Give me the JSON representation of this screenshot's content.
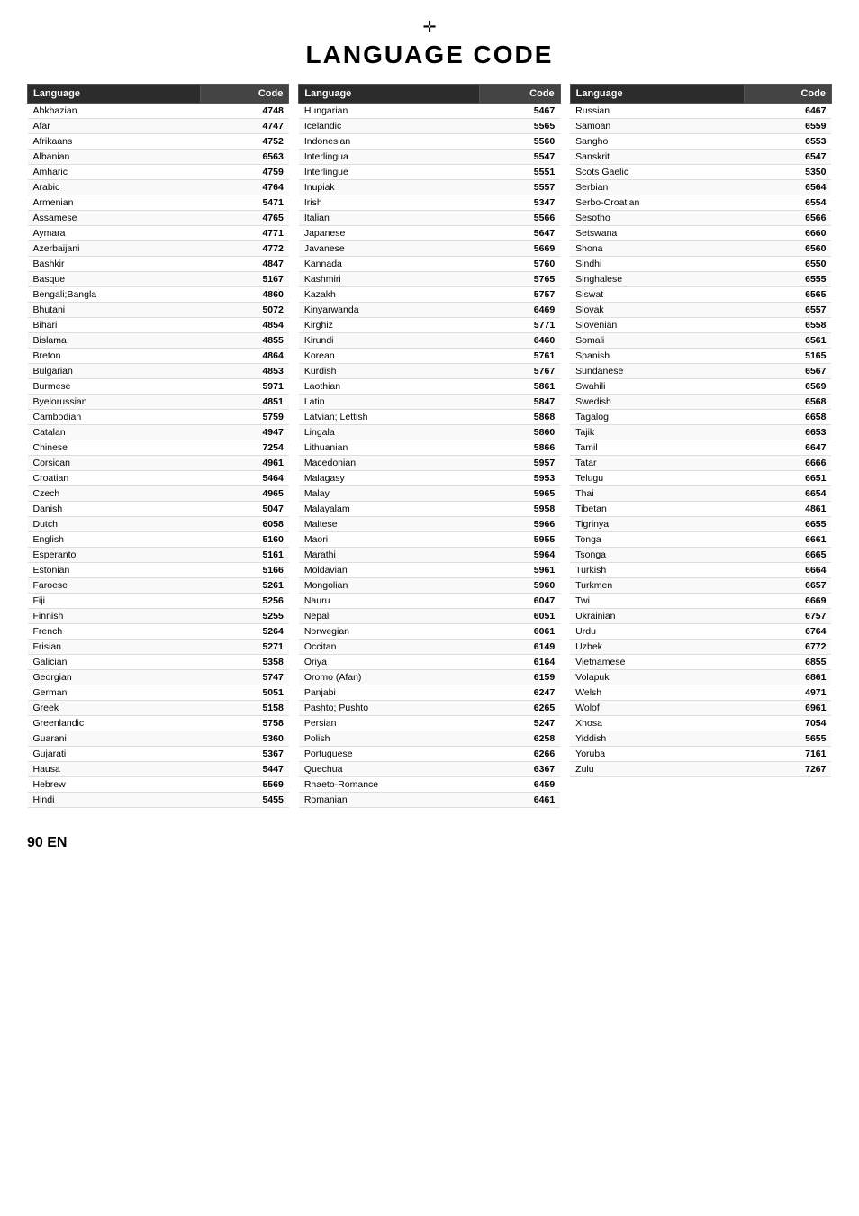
{
  "title": "LANGUAGE CODE",
  "columns": [
    {
      "header_lang": "Language",
      "header_code": "Code",
      "rows": [
        {
          "lang": "Abkhazian",
          "code": "4748"
        },
        {
          "lang": "Afar",
          "code": "4747"
        },
        {
          "lang": "Afrikaans",
          "code": "4752"
        },
        {
          "lang": "Albanian",
          "code": "6563"
        },
        {
          "lang": "Amharic",
          "code": "4759"
        },
        {
          "lang": "Arabic",
          "code": "4764"
        },
        {
          "lang": "Armenian",
          "code": "5471"
        },
        {
          "lang": "Assamese",
          "code": "4765"
        },
        {
          "lang": "Aymara",
          "code": "4771"
        },
        {
          "lang": "Azerbaijani",
          "code": "4772"
        },
        {
          "lang": "Bashkir",
          "code": "4847"
        },
        {
          "lang": "Basque",
          "code": "5167"
        },
        {
          "lang": "Bengali;Bangla",
          "code": "4860"
        },
        {
          "lang": "Bhutani",
          "code": "5072"
        },
        {
          "lang": "Bihari",
          "code": "4854"
        },
        {
          "lang": "Bislama",
          "code": "4855"
        },
        {
          "lang": "Breton",
          "code": "4864"
        },
        {
          "lang": "Bulgarian",
          "code": "4853"
        },
        {
          "lang": "Burmese",
          "code": "5971"
        },
        {
          "lang": "Byelorussian",
          "code": "4851"
        },
        {
          "lang": "Cambodian",
          "code": "5759"
        },
        {
          "lang": "Catalan",
          "code": "4947"
        },
        {
          "lang": "Chinese",
          "code": "7254"
        },
        {
          "lang": "Corsican",
          "code": "4961"
        },
        {
          "lang": "Croatian",
          "code": "5464"
        },
        {
          "lang": "Czech",
          "code": "4965"
        },
        {
          "lang": "Danish",
          "code": "5047"
        },
        {
          "lang": "Dutch",
          "code": "6058"
        },
        {
          "lang": "English",
          "code": "5160"
        },
        {
          "lang": "Esperanto",
          "code": "5161"
        },
        {
          "lang": "Estonian",
          "code": "5166"
        },
        {
          "lang": "Faroese",
          "code": "5261"
        },
        {
          "lang": "Fiji",
          "code": "5256"
        },
        {
          "lang": "Finnish",
          "code": "5255"
        },
        {
          "lang": "French",
          "code": "5264"
        },
        {
          "lang": "Frisian",
          "code": "5271"
        },
        {
          "lang": "Galician",
          "code": "5358"
        },
        {
          "lang": "Georgian",
          "code": "5747"
        },
        {
          "lang": "German",
          "code": "5051"
        },
        {
          "lang": "Greek",
          "code": "5158"
        },
        {
          "lang": "Greenlandic",
          "code": "5758"
        },
        {
          "lang": "Guarani",
          "code": "5360"
        },
        {
          "lang": "Gujarati",
          "code": "5367"
        },
        {
          "lang": "Hausa",
          "code": "5447"
        },
        {
          "lang": "Hebrew",
          "code": "5569"
        },
        {
          "lang": "Hindi",
          "code": "5455"
        }
      ]
    },
    {
      "header_lang": "Language",
      "header_code": "Code",
      "rows": [
        {
          "lang": "Hungarian",
          "code": "5467"
        },
        {
          "lang": "Icelandic",
          "code": "5565"
        },
        {
          "lang": "Indonesian",
          "code": "5560"
        },
        {
          "lang": "Interlingua",
          "code": "5547"
        },
        {
          "lang": "Interlingue",
          "code": "5551"
        },
        {
          "lang": "Inupiak",
          "code": "5557"
        },
        {
          "lang": "Irish",
          "code": "5347"
        },
        {
          "lang": "Italian",
          "code": "5566"
        },
        {
          "lang": "Japanese",
          "code": "5647"
        },
        {
          "lang": "Javanese",
          "code": "5669"
        },
        {
          "lang": "Kannada",
          "code": "5760"
        },
        {
          "lang": "Kashmiri",
          "code": "5765"
        },
        {
          "lang": "Kazakh",
          "code": "5757"
        },
        {
          "lang": "Kinyarwanda",
          "code": "6469"
        },
        {
          "lang": "Kirghiz",
          "code": "5771"
        },
        {
          "lang": "Kirundi",
          "code": "6460"
        },
        {
          "lang": "Korean",
          "code": "5761"
        },
        {
          "lang": "Kurdish",
          "code": "5767"
        },
        {
          "lang": "Laothian",
          "code": "5861"
        },
        {
          "lang": "Latin",
          "code": "5847"
        },
        {
          "lang": "Latvian; Lettish",
          "code": "5868"
        },
        {
          "lang": "Lingala",
          "code": "5860"
        },
        {
          "lang": "Lithuanian",
          "code": "5866"
        },
        {
          "lang": "Macedonian",
          "code": "5957"
        },
        {
          "lang": "Malagasy",
          "code": "5953"
        },
        {
          "lang": "Malay",
          "code": "5965"
        },
        {
          "lang": "Malayalam",
          "code": "5958"
        },
        {
          "lang": "Maltese",
          "code": "5966"
        },
        {
          "lang": "Maori",
          "code": "5955"
        },
        {
          "lang": "Marathi",
          "code": "5964"
        },
        {
          "lang": "Moldavian",
          "code": "5961"
        },
        {
          "lang": "Mongolian",
          "code": "5960"
        },
        {
          "lang": "Nauru",
          "code": "6047"
        },
        {
          "lang": "Nepali",
          "code": "6051"
        },
        {
          "lang": "Norwegian",
          "code": "6061"
        },
        {
          "lang": "Occitan",
          "code": "6149"
        },
        {
          "lang": "Oriya",
          "code": "6164"
        },
        {
          "lang": "Oromo (Afan)",
          "code": "6159"
        },
        {
          "lang": "Panjabi",
          "code": "6247"
        },
        {
          "lang": "Pashto; Pushto",
          "code": "6265"
        },
        {
          "lang": "Persian",
          "code": "5247"
        },
        {
          "lang": "Polish",
          "code": "6258"
        },
        {
          "lang": "Portuguese",
          "code": "6266"
        },
        {
          "lang": "Quechua",
          "code": "6367"
        },
        {
          "lang": "Rhaeto-Romance",
          "code": "6459"
        },
        {
          "lang": "Romanian",
          "code": "6461"
        }
      ]
    },
    {
      "header_lang": "Language",
      "header_code": "Code",
      "rows": [
        {
          "lang": "Russian",
          "code": "6467"
        },
        {
          "lang": "Samoan",
          "code": "6559"
        },
        {
          "lang": "Sangho",
          "code": "6553"
        },
        {
          "lang": "Sanskrit",
          "code": "6547"
        },
        {
          "lang": "Scots Gaelic",
          "code": "5350"
        },
        {
          "lang": "Serbian",
          "code": "6564"
        },
        {
          "lang": "Serbo-Croatian",
          "code": "6554"
        },
        {
          "lang": "Sesotho",
          "code": "6566"
        },
        {
          "lang": "Setswana",
          "code": "6660"
        },
        {
          "lang": "Shona",
          "code": "6560"
        },
        {
          "lang": "Sindhi",
          "code": "6550"
        },
        {
          "lang": "Singhalese",
          "code": "6555"
        },
        {
          "lang": "Siswat",
          "code": "6565"
        },
        {
          "lang": "Slovak",
          "code": "6557"
        },
        {
          "lang": "Slovenian",
          "code": "6558"
        },
        {
          "lang": "Somali",
          "code": "6561"
        },
        {
          "lang": "Spanish",
          "code": "5165"
        },
        {
          "lang": "Sundanese",
          "code": "6567"
        },
        {
          "lang": "Swahili",
          "code": "6569"
        },
        {
          "lang": "Swedish",
          "code": "6568"
        },
        {
          "lang": "Tagalog",
          "code": "6658"
        },
        {
          "lang": "Tajik",
          "code": "6653"
        },
        {
          "lang": "Tamil",
          "code": "6647"
        },
        {
          "lang": "Tatar",
          "code": "6666"
        },
        {
          "lang": "Telugu",
          "code": "6651"
        },
        {
          "lang": "Thai",
          "code": "6654"
        },
        {
          "lang": "Tibetan",
          "code": "4861"
        },
        {
          "lang": "Tigrinya",
          "code": "6655"
        },
        {
          "lang": "Tonga",
          "code": "6661"
        },
        {
          "lang": "Tsonga",
          "code": "6665"
        },
        {
          "lang": "Turkish",
          "code": "6664"
        },
        {
          "lang": "Turkmen",
          "code": "6657"
        },
        {
          "lang": "Twi",
          "code": "6669"
        },
        {
          "lang": "Ukrainian",
          "code": "6757"
        },
        {
          "lang": "Urdu",
          "code": "6764"
        },
        {
          "lang": "Uzbek",
          "code": "6772"
        },
        {
          "lang": "Vietnamese",
          "code": "6855"
        },
        {
          "lang": "Volapuk",
          "code": "6861"
        },
        {
          "lang": "Welsh",
          "code": "4971"
        },
        {
          "lang": "Wolof",
          "code": "6961"
        },
        {
          "lang": "Xhosa",
          "code": "7054"
        },
        {
          "lang": "Yiddish",
          "code": "5655"
        },
        {
          "lang": "Yoruba",
          "code": "7161"
        },
        {
          "lang": "Zulu",
          "code": "7267"
        }
      ]
    }
  ],
  "footer": "90  EN"
}
